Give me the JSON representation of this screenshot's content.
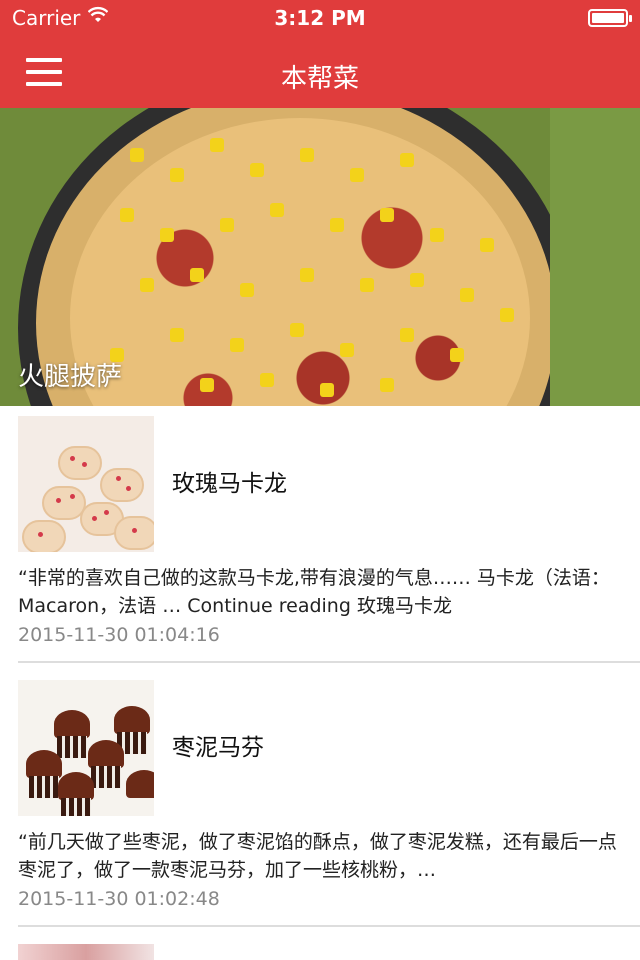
{
  "status_bar": {
    "carrier": "Carrier",
    "time": "3:12 PM",
    "wifi_icon": "wifi-icon",
    "battery_icon": "battery-icon"
  },
  "nav_bar": {
    "title": "本帮菜",
    "menu_icon": "hamburger-menu-icon",
    "background_color": "#e03c3c"
  },
  "featured": {
    "caption": "火腿披萨"
  },
  "articles": [
    {
      "title": "玫瑰马卡龙",
      "excerpt": "“非常的喜欢自己做的这款马卡龙,带有浪漫的气息…… 马卡龙（法语：Macaron，法语 … Continue reading 玫瑰马卡龙",
      "date": "2015-11-30 01:04:16"
    },
    {
      "title": "枣泥马芬",
      "excerpt": "“前几天做了些枣泥，做了枣泥馅的酥点，做了枣泥发糕，还有最后一点枣泥了，做了一款枣泥马芬，加了一些核桃粉，…",
      "date": "2015-11-30 01:02:48"
    }
  ]
}
